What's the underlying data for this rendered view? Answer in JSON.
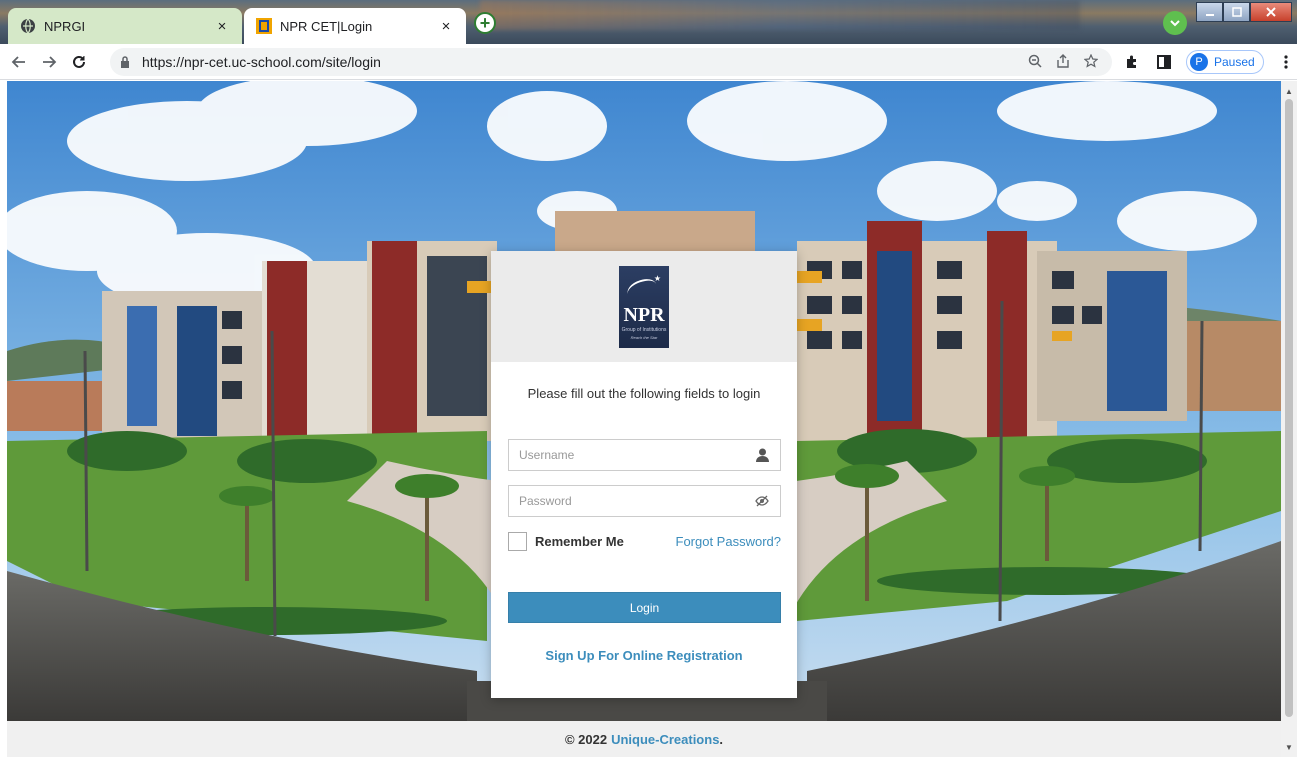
{
  "browser": {
    "tabs": [
      {
        "title": "NPRGI",
        "close": "×"
      },
      {
        "title": "NPR CET|Login",
        "close": "×"
      }
    ],
    "new_tab_symbol": "+",
    "address": {
      "url": "https://npr-cet.uc-school.com/site/login"
    },
    "profile": {
      "initial": "P",
      "status": "Paused"
    }
  },
  "login": {
    "logo": {
      "name": "NPR",
      "subtitle": "Group of Institutions",
      "tagline": "Reach the Star"
    },
    "prompt": "Please fill out the following fields to login",
    "username_placeholder": "Username",
    "password_placeholder": "Password",
    "remember_label": "Remember Me",
    "forgot_label": "Forgot Password?",
    "login_label": "Login",
    "signup_label": "Sign Up For Online Registration"
  },
  "footer": {
    "copyright": "© 2022",
    "brand": "Unique-Creations",
    "suffix": "."
  },
  "colors": {
    "accent": "#3c8dbc",
    "card_header": "#ebebeb",
    "footer_bg": "#f0f0f0"
  }
}
